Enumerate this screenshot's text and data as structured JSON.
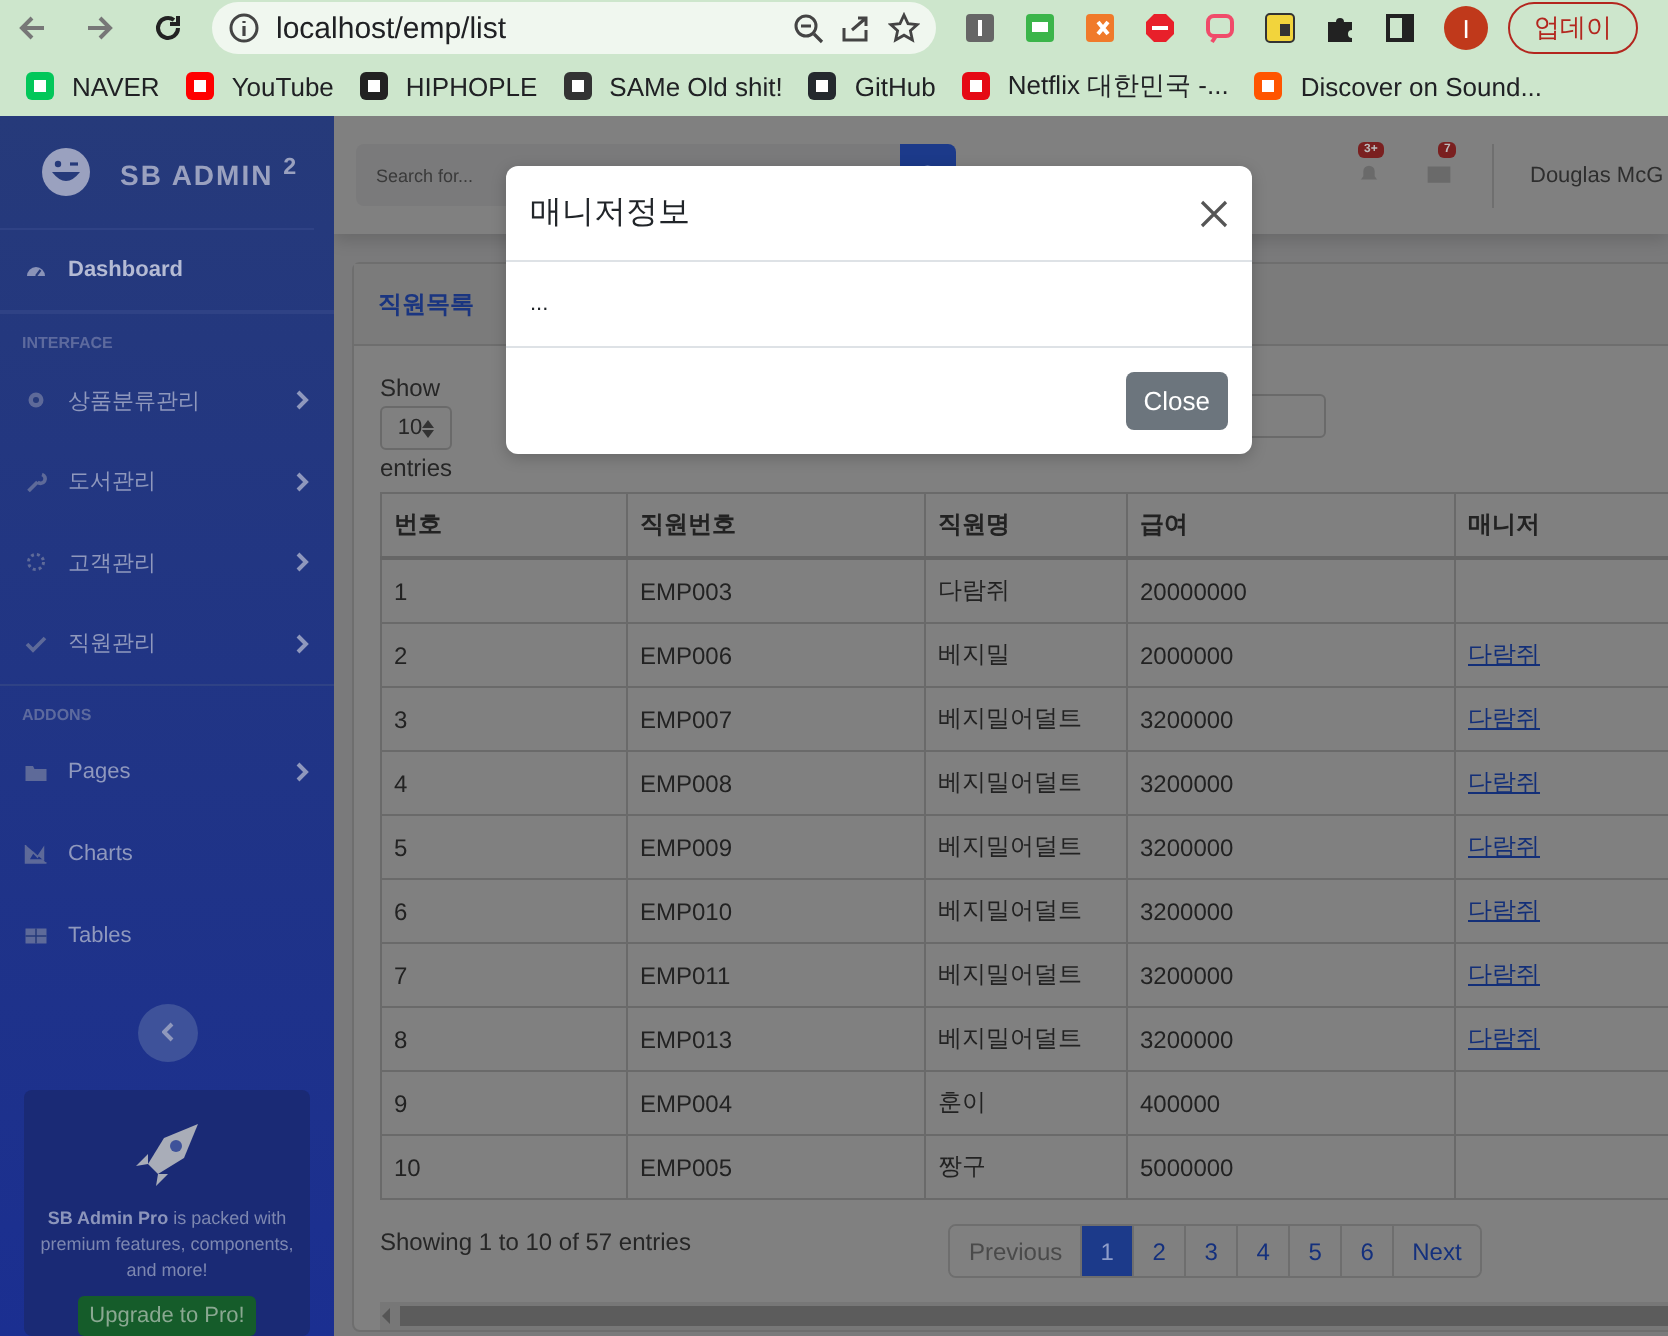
{
  "browser": {
    "url": "localhost/emp/list",
    "profile_initial": "I",
    "update_button": "업데이",
    "bookmarks": [
      {
        "label": "NAVER",
        "color": "#03c75a"
      },
      {
        "label": "YouTube",
        "color": "#ff0000"
      },
      {
        "label": "HIPHOPLE",
        "color": "#222222"
      },
      {
        "label": "SAMe Old shit!",
        "color": "#333333"
      },
      {
        "label": "GitHub",
        "color": "#24292e"
      },
      {
        "label": "Netflix 대한민국 -...",
        "color": "#e50914"
      },
      {
        "label": "Discover on Sound...",
        "color": "#ff5500"
      }
    ]
  },
  "sidebar": {
    "brand": "SB ADMIN $^{2}$",
    "items": [
      {
        "kind": "link",
        "label": "Dashboard",
        "selected": true,
        "expandable": false
      },
      {
        "kind": "heading",
        "label": "INTERFACE"
      },
      {
        "kind": "link",
        "label": "상품분류관리",
        "selected": false,
        "expandable": true
      },
      {
        "kind": "link",
        "label": "도서관리",
        "selected": false,
        "expandable": true
      },
      {
        "kind": "link",
        "label": "고객관리",
        "selected": false,
        "expandable": true
      },
      {
        "kind": "link",
        "label": "직원관리",
        "selected": false,
        "expandable": true
      },
      {
        "kind": "heading",
        "label": "ADDONS"
      },
      {
        "kind": "link",
        "label": "Pages",
        "selected": false,
        "expandable": true
      },
      {
        "kind": "link",
        "label": "Charts",
        "selected": false,
        "expandable": false
      },
      {
        "kind": "link",
        "label": "Tables",
        "selected": false,
        "expandable": false
      }
    ],
    "promo": {
      "text": "**SB Admin Pro** is packed with premium features, components, and more!",
      "button": "Upgrade to Pro!"
    }
  },
  "topbar": {
    "search_placeholder": "Search for...",
    "alerts_badge": "3+",
    "messages_badge": "7",
    "user_name": "Douglas McG"
  },
  "card": {
    "title": "직원목록",
    "length_before": "Show",
    "length_value": "10",
    "length_after": "entries",
    "columns": [
      "번호",
      "직원번호",
      "직원명",
      "급여",
      "매니저"
    ],
    "rows": [
      {
        "no": "1",
        "emp_no": "EMP003",
        "name": "다람쥐",
        "salary": "20000000"
      },
      {
        "no": "2",
        "emp_no": "EMP006",
        "name": "베지밀",
        "salary": "2000000",
        "manager": "다람쥐"
      },
      {
        "no": "3",
        "emp_no": "EMP007",
        "name": "베지밀어덜트",
        "salary": "3200000",
        "manager": "다람쥐"
      },
      {
        "no": "4",
        "emp_no": "EMP008",
        "name": "베지밀어덜트",
        "salary": "3200000",
        "manager": "다람쥐"
      },
      {
        "no": "5",
        "emp_no": "EMP009",
        "name": "베지밀어덜트",
        "salary": "3200000",
        "manager": "다람쥐"
      },
      {
        "no": "6",
        "emp_no": "EMP010",
        "name": "베지밀어덜트",
        "salary": "3200000",
        "manager": "다람쥐"
      },
      {
        "no": "7",
        "emp_no": "EMP011",
        "name": "베지밀어덜트",
        "salary": "3200000",
        "manager": "다람쥐"
      },
      {
        "no": "8",
        "emp_no": "EMP013",
        "name": "베지밀어덜트",
        "salary": "3200000",
        "manager": "다람쥐"
      },
      {
        "no": "9",
        "emp_no": "EMP004",
        "name": "훈이",
        "salary": "400000"
      },
      {
        "no": "10",
        "emp_no": "EMP005",
        "name": "짱구",
        "salary": "5000000"
      }
    ],
    "info": "Showing 1 to 10 of 57 entries",
    "pagination": [
      {
        "label": "Previous",
        "selected": false,
        "disabled": true
      },
      {
        "label": "1",
        "selected": true,
        "disabled": false
      },
      {
        "label": "2",
        "selected": false,
        "disabled": false
      },
      {
        "label": "3",
        "selected": false,
        "disabled": false
      },
      {
        "label": "4",
        "selected": false,
        "disabled": false
      },
      {
        "label": "5",
        "selected": false,
        "disabled": false
      },
      {
        "label": "6",
        "selected": false,
        "disabled": false
      },
      {
        "label": "Next",
        "selected": false,
        "disabled": false
      }
    ]
  },
  "modal": {
    "title": "매니저정보",
    "body": "...",
    "close_button": "Close"
  }
}
